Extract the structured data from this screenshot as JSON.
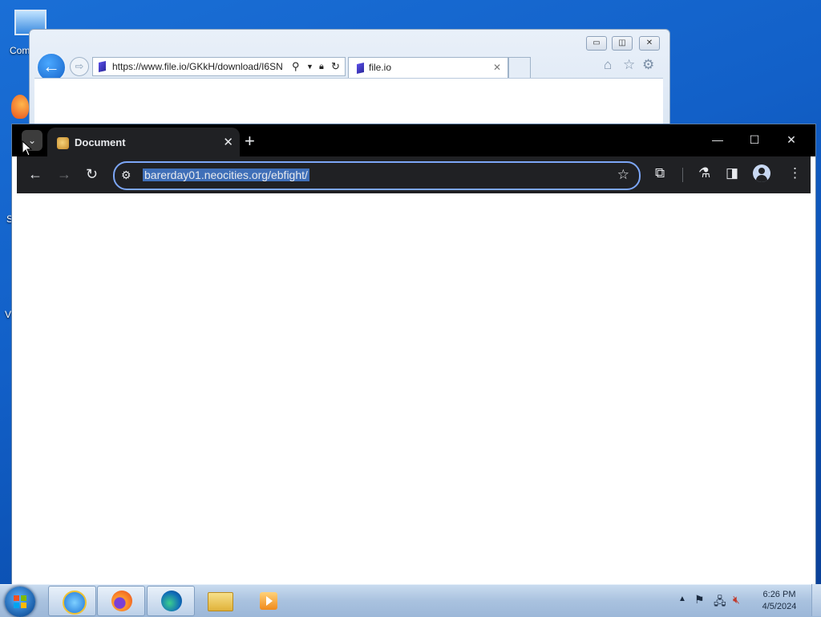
{
  "desktop": {
    "icons": [
      {
        "label": "Com",
        "icon": "computer-icon"
      }
    ],
    "partial_labels": [
      "S",
      "V"
    ]
  },
  "ie": {
    "address": "https://www.file.io/GKkH/download/I6SN",
    "tab_title": "file.io",
    "buttons": {
      "minimize": "▭",
      "restore": "◫",
      "close": "✕"
    }
  },
  "chrome": {
    "tab_title": "Document",
    "new_tab": "+",
    "url": "barerday01.neocities.org/ebfight/",
    "window_controls": {
      "minimize": "—",
      "maximize": "☐",
      "close": "✕"
    }
  },
  "taskbar": {
    "apps": [
      "internet-explorer-icon",
      "firefox-icon",
      "edge-icon",
      "file-explorer-icon",
      "media-player-icon"
    ],
    "time": "6:26 PM",
    "date": "4/5/2024"
  },
  "colors": {
    "chrome_titlebar": "#000000",
    "chrome_toolbar": "#202124",
    "omnibox_focus": "#7ca6f7",
    "url_selection": "#3f6fb8",
    "desktop": "#1260c8"
  }
}
